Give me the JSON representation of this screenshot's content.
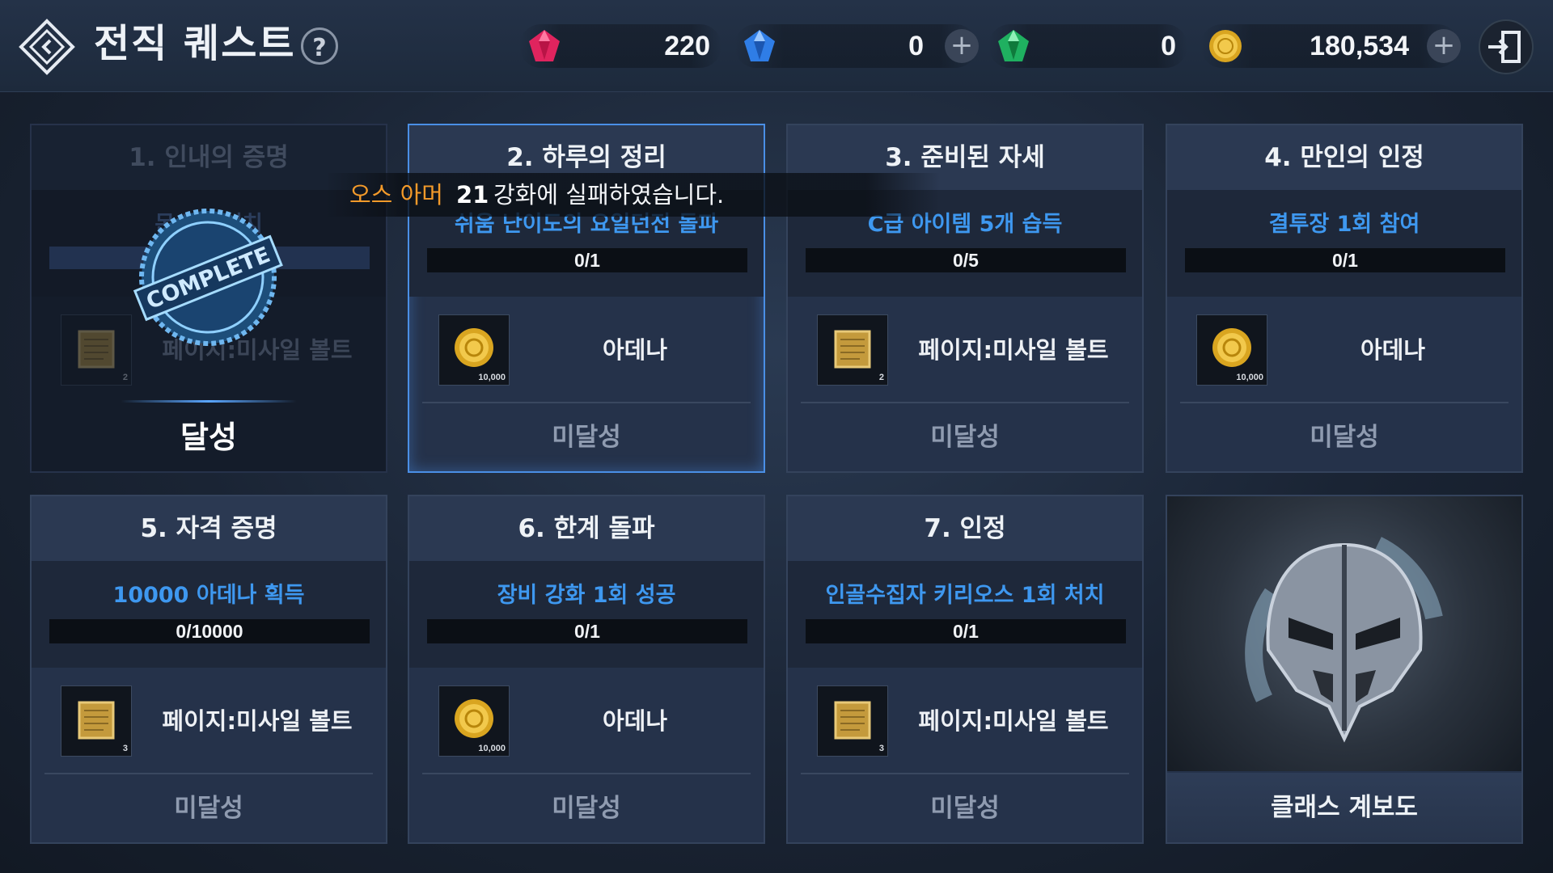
{
  "header": {
    "title": "전직 퀘스트",
    "help_label": "?",
    "currencies": [
      {
        "icon": "red-gem-icon",
        "value": "220"
      },
      {
        "icon": "blue-gem-icon",
        "value": "0"
      },
      {
        "icon": "green-gem-icon",
        "value": "0"
      },
      {
        "icon": "adena-coin-icon",
        "value": "180,534"
      }
    ],
    "plus_label": "+"
  },
  "toast": {
    "item_name": "오스 아머",
    "level": "21",
    "message": "강화에 실패하였습니다."
  },
  "quests": [
    {
      "title": "1. 인내의 증명",
      "objective": "몬스터 처치",
      "progress": "",
      "reward": "페이지:미사일 볼트",
      "reward_icon": "scroll-icon",
      "reward_qty": "2",
      "status": "달성",
      "completed": true,
      "stamp": "COMPLETE"
    },
    {
      "title": "2. 하루의 정리",
      "objective": "쉬움 난이도의 요일던전 돌파",
      "progress": "0/1",
      "reward": "아데나",
      "reward_icon": "adena-coin-icon",
      "reward_qty": "10,000",
      "status": "미달성",
      "completed": false
    },
    {
      "title": "3. 준비된 자세",
      "objective": "C급 아이템 5개 습득",
      "progress": "0/5",
      "reward": "페이지:미사일 볼트",
      "reward_icon": "scroll-icon",
      "reward_qty": "2",
      "status": "미달성",
      "completed": false
    },
    {
      "title": "4. 만인의 인정",
      "objective": "결투장 1회 참여",
      "progress": "0/1",
      "reward": "아데나",
      "reward_icon": "adena-coin-icon",
      "reward_qty": "10,000",
      "status": "미달성",
      "completed": false
    },
    {
      "title": "5. 자격 증명",
      "objective": "10000 아데나 획득",
      "progress": "0/10000",
      "reward": "페이지:미사일 볼트",
      "reward_icon": "scroll-icon",
      "reward_qty": "3",
      "status": "미달성",
      "completed": false
    },
    {
      "title": "6. 한계 돌파",
      "objective": "장비 강화 1회 성공",
      "progress": "0/1",
      "reward": "아데나",
      "reward_icon": "adena-coin-icon",
      "reward_qty": "10,000",
      "status": "미달성",
      "completed": false
    },
    {
      "title": "7. 인정",
      "objective": "인골수집자 키리오스 1회 처치",
      "progress": "0/1",
      "reward": "페이지:미사일 볼트",
      "reward_icon": "scroll-icon",
      "reward_qty": "3",
      "status": "미달성",
      "completed": false
    }
  ],
  "class_board": {
    "label": "클래스 계보도",
    "icon": "knight-helmet-icon"
  },
  "colors": {
    "objective": "#3e98f0",
    "toast_item": "#f39a2a",
    "selected_border": "#4a8fe6"
  }
}
